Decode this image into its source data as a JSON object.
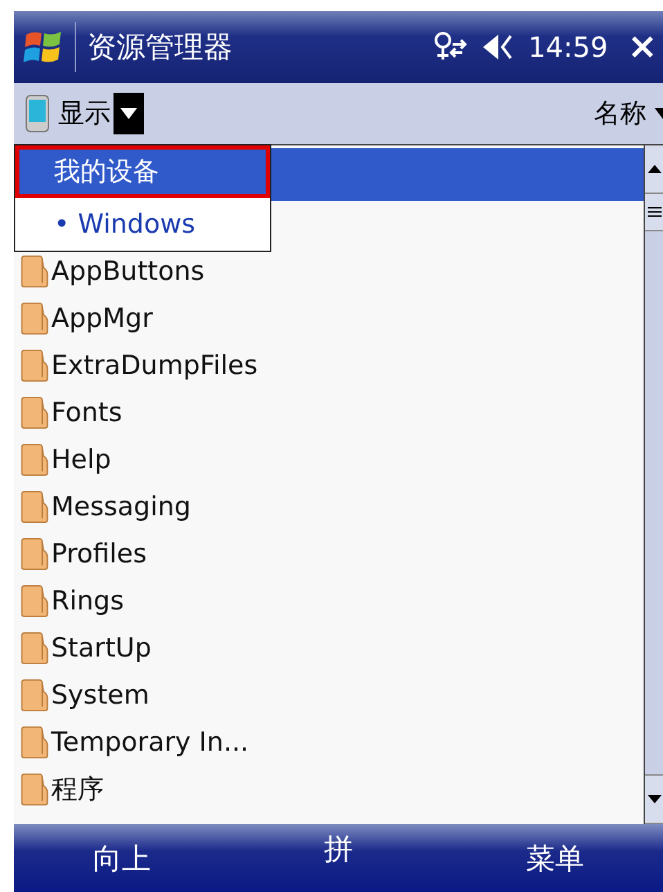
{
  "title_bar": {
    "title": "资源管理器",
    "time": "14:59",
    "close": "×"
  },
  "toolbar": {
    "label": "显示",
    "sort_label": "名称"
  },
  "dropdown": {
    "items": [
      {
        "label": "我的设备",
        "selected": true
      },
      {
        "label": "• Windows",
        "selected": false
      }
    ]
  },
  "list": {
    "selected_hidden_row": true,
    "items": [
      "AppButtons",
      "AppMgr",
      "ExtraDumpFiles",
      "Fonts",
      "Help",
      "Messaging",
      "Profiles",
      "Rings",
      "StartUp",
      "System",
      "Temporary In...",
      "程序"
    ]
  },
  "bottom_bar": {
    "left": "向上",
    "center": "拼",
    "right": "菜单"
  }
}
